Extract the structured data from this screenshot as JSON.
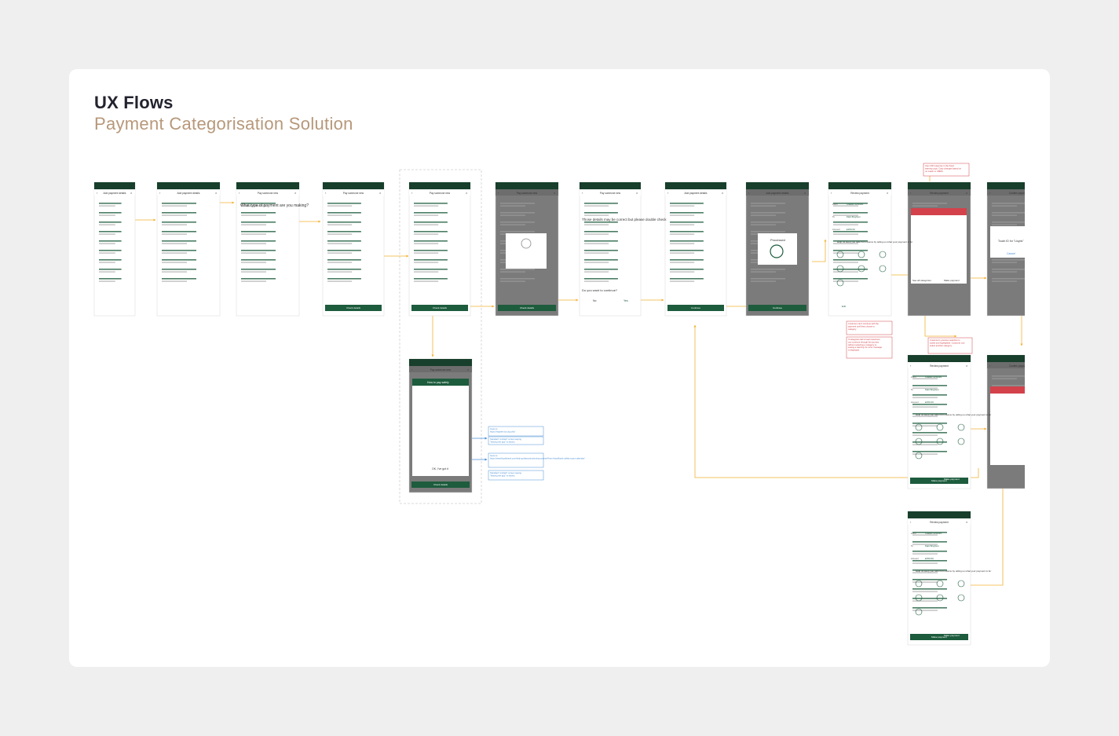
{
  "header": {
    "title": "UX Flows",
    "subtitle": "Payment Categorisation Solution"
  },
  "colors": {
    "page_bg": "#efefef",
    "card_bg": "#ffffff",
    "brand_green": "#1d5c3d",
    "dark_green": "#173f2b",
    "subtitle_tan": "#b7987a",
    "connector_orange": "#f2b233",
    "note_red": "#d3424b",
    "note_blue": "#4a8fd6",
    "overlay_grey": "#7b7b7b"
  },
  "screens": [
    {
      "title": "Add payment details",
      "variant": "white",
      "cta": ""
    },
    {
      "title": "Add payment details",
      "variant": "white",
      "cta": ""
    },
    {
      "title": "Pay someone new",
      "variant": "white",
      "cta": ""
    },
    {
      "title": "Pay someone new",
      "variant": "white",
      "cta": "Check details"
    },
    {
      "title": "Pay someone new",
      "variant": "white",
      "cta": "Check details"
    },
    {
      "title": "Pay someone new",
      "variant": "grey",
      "cta": "Check details"
    },
    {
      "title": "Pay someone new",
      "variant": "white",
      "cta": ""
    },
    {
      "title": "Add payment details",
      "variant": "white",
      "cta": "Continue"
    },
    {
      "title": "Add payment details",
      "variant": "grey",
      "cta": "Continue"
    },
    {
      "title": "Review payment",
      "variant": "white",
      "cta": ""
    },
    {
      "title": "Review payment",
      "variant": "grey",
      "cta": ""
    },
    {
      "title": "Confirm payment",
      "variant": "grey",
      "cta": ""
    },
    {
      "title": "Pay someone new",
      "variant": "grey",
      "cta": "Check details"
    },
    {
      "title": "Review payment",
      "variant": "white",
      "cta": "Make payment"
    },
    {
      "title": "Confirm payment",
      "variant": "grey",
      "cta": ""
    },
    {
      "title": "Review payment",
      "variant": "white",
      "cta": "Make payment"
    }
  ],
  "screen_texts": {
    "pay_type_question": "What type of payment are you making?",
    "details_warning": "Those details may be correct but please double check",
    "continue_question": "Do you want to continue?",
    "no_label": "No",
    "yes_label": "Yes",
    "processed_label": "Processed",
    "help_scam": "Help us keep you safe from scams by telling us what your payment is for",
    "how_to_pay_safely": "How to pay safely",
    "got_it": "OK, I've got it",
    "edit_label": "Edit",
    "make_payment_label": "Make payment",
    "see_all_categories": "See all categories",
    "touch_id": "Touch ID for \"Lloyds\"",
    "cancel_label": "Cancel",
    "from_label": "From",
    "to_label": "To",
    "amount_label": "Amount",
    "classic_account": "Classic Account",
    "payee_name": "Matt Brighton",
    "amount_value": "£250.00"
  },
  "notes": [
    {
      "text": "Use C4P response in the fraud warning copy. Copy changes based on no match or CBDN.",
      "color": "red"
    },
    {
      "text": "Customer can't continue with the payment until they choose a category.",
      "color": "red"
    },
    {
      "text": "If categories fail to load customers can continue through the journey without selecting a category or seeing a warning. An error message is displayed.",
      "color": "red"
    },
    {
      "text": "Customer's previous selection is saved and highlighted. Customer can select another category.",
      "color": "red"
    },
    {
      "text": "Goes to https://register.fca.org.uk/s/",
      "color": "blue"
    },
    {
      "text": "Standard \"embark\" screen saying \"leaving the app\" is shown.",
      "color": "blue"
    },
    {
      "text": "Goes to https://www.lloydsbank.com/help-guidance/protecting-yourself-from-fraud/bank-safely-scam-calendar/",
      "color": "blue"
    },
    {
      "text": "Standard \"embark\" screen saying \"leaving the app\" is shown.",
      "color": "blue"
    }
  ]
}
